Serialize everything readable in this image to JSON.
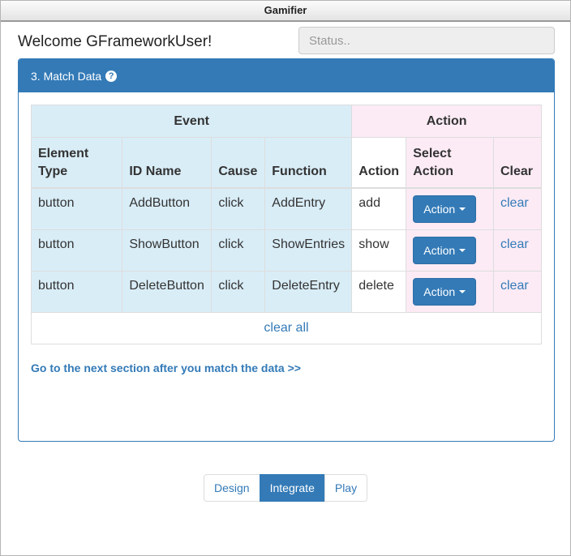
{
  "window": {
    "title": "Gamifier"
  },
  "header": {
    "welcome": "Welcome GFrameworkUser!",
    "status_placeholder": "Status.."
  },
  "panel": {
    "title": "3. Match Data",
    "help_icon": "question-circle-icon"
  },
  "table": {
    "group_event": "Event",
    "group_action": "Action",
    "columns": {
      "element_type_l1": "Element",
      "element_type_l2": "Type",
      "id_name": "ID Name",
      "cause": "Cause",
      "function": "Function",
      "action": "Action",
      "select_action_l1": "Select",
      "select_action_l2": "Action",
      "clear": "Clear"
    },
    "rows": [
      {
        "element_type": "button",
        "id_name": "AddButton",
        "cause": "click",
        "function": "AddEntry",
        "action": "add",
        "select_label": "Action",
        "clear": "clear"
      },
      {
        "element_type": "button",
        "id_name": "ShowButton",
        "cause": "click",
        "function": "ShowEntries",
        "action": "show",
        "select_label": "Action",
        "clear": "clear"
      },
      {
        "element_type": "button",
        "id_name": "DeleteButton",
        "cause": "click",
        "function": "DeleteEntry",
        "action": "delete",
        "select_label": "Action",
        "clear": "clear"
      }
    ],
    "clear_all": "clear all"
  },
  "next_link": "Go to the next section after you match the data >>",
  "pager": {
    "items": [
      "Design",
      "Integrate",
      "Play"
    ],
    "active": "Integrate"
  },
  "colors": {
    "primary": "#337ab7",
    "event_bg": "#d9edf7",
    "action_bg": "#fcebf5"
  }
}
